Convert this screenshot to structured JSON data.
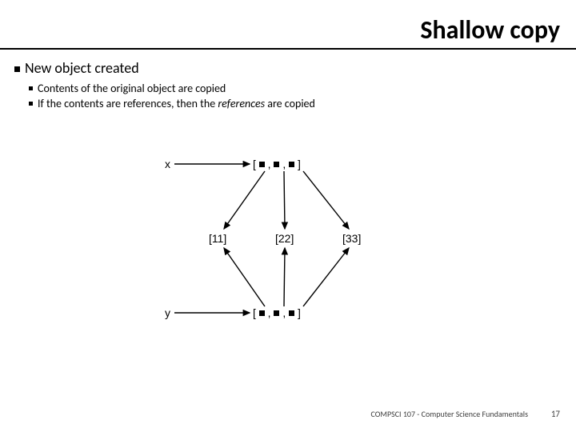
{
  "title": "Shallow copy",
  "bullets": {
    "lvl1": "New object created",
    "lvl2a": "Contents of the original object are copied",
    "lvl2b_pre": "If the contents are references, then the ",
    "lvl2b_emph": "references",
    "lvl2b_post": " are copied"
  },
  "diagram": {
    "x_label": "x",
    "y_label": "y",
    "list_open": "[",
    "list_close": "]",
    "comma": ",",
    "sub1": "[11]",
    "sub2": "[22]",
    "sub3": "[33]"
  },
  "footer": {
    "course": "COMPSCI 107 - Computer Science Fundamentals",
    "page": "17"
  },
  "chart_data": {
    "type": "table",
    "description": "Reference diagram: two outer lists x and y each hold 3 references pointing to the same three inner lists.",
    "variables": [
      "x",
      "y"
    ],
    "shared_inner_lists": [
      [
        11
      ],
      [
        22
      ],
      [
        33
      ]
    ],
    "edges": [
      [
        "x[0]",
        "[11]"
      ],
      [
        "x[1]",
        "[22]"
      ],
      [
        "x[2]",
        "[33]"
      ],
      [
        "y[0]",
        "[11]"
      ],
      [
        "y[1]",
        "[22]"
      ],
      [
        "y[2]",
        "[33]"
      ]
    ]
  }
}
